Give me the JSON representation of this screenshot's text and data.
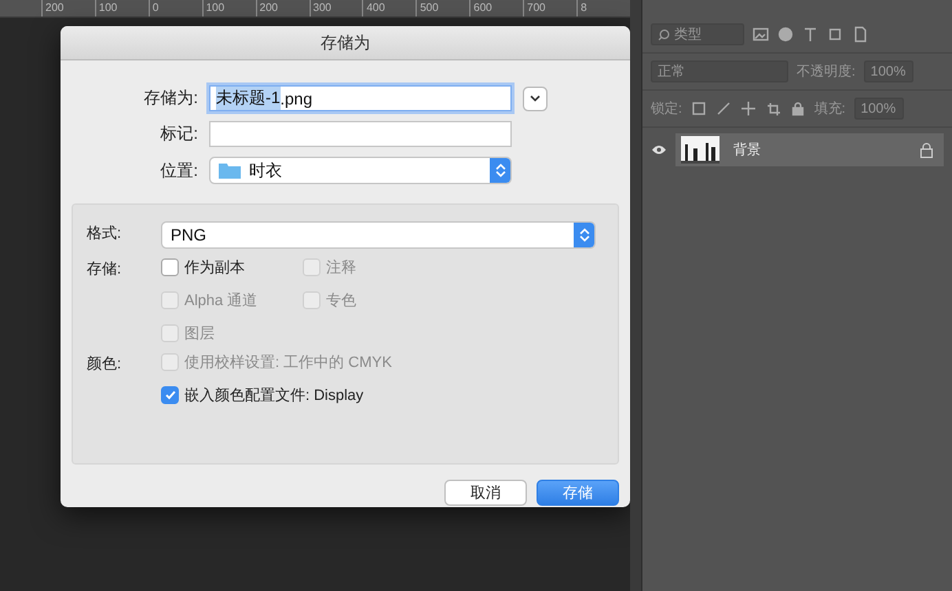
{
  "ruler": {
    "labels": [
      "200",
      "100",
      "0",
      "100",
      "200",
      "300",
      "400",
      "500",
      "600",
      "700",
      "8"
    ]
  },
  "layers_panel": {
    "filter": "类型",
    "blend_mode": "正常",
    "opacity_label": "不透明度:",
    "opacity": "100%",
    "lock_label": "锁定:",
    "fill_label": "填充:",
    "fill": "100%",
    "layers": [
      {
        "name": "背景",
        "visible": true,
        "locked": true,
        "selected": true
      }
    ]
  },
  "dialog": {
    "title": "存储为",
    "fields": [
      {
        "kind": "name",
        "label": "存储为:",
        "value": "未标题-1",
        "value_rest": ".png"
      },
      {
        "kind": "text",
        "label": "标记:"
      },
      {
        "kind": "location",
        "label": "位置:",
        "value": "时衣"
      }
    ],
    "format": {
      "label": "格式:",
      "value": "PNG"
    },
    "sections": [
      {
        "label": "存储:",
        "rows": [
          [
            {
              "label": "作为副本",
              "checked": false,
              "disabled": false
            },
            {
              "label": "注释",
              "checked": false,
              "disabled": true
            }
          ],
          [
            {
              "label": "Alpha 通道",
              "checked": false,
              "disabled": true
            },
            {
              "label": "专色",
              "checked": false,
              "disabled": true
            }
          ],
          [
            {
              "label": "图层",
              "checked": false,
              "disabled": true
            }
          ]
        ]
      },
      {
        "label": "颜色:",
        "rows": [
          [
            {
              "label": "使用校样设置: 工作中的 CMYK",
              "checked": false,
              "disabled": true
            }
          ],
          [
            {
              "label": "嵌入颜色配置文件: Display",
              "checked": true,
              "disabled": false
            }
          ]
        ]
      }
    ],
    "buttons": [
      {
        "label": "取消",
        "primary": false
      },
      {
        "label": "存储",
        "primary": true
      }
    ]
  }
}
